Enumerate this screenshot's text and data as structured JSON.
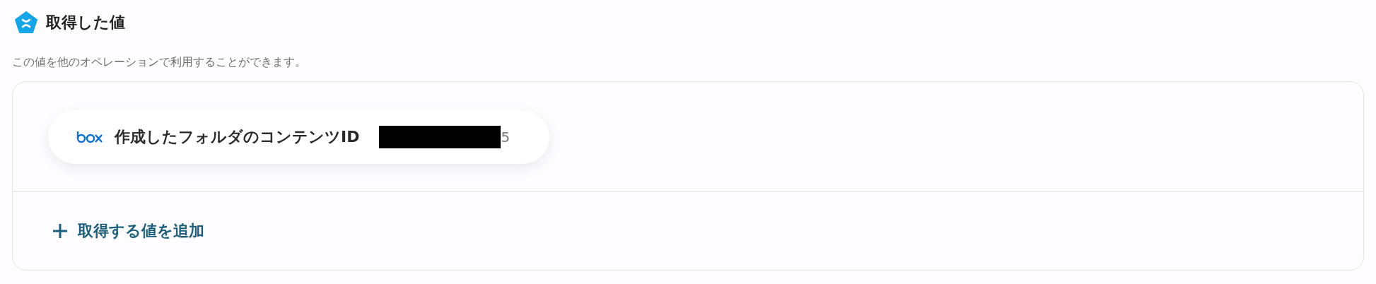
{
  "header": {
    "title": "取得した値",
    "description": "この値を他のオペレーションで利用することができます。"
  },
  "values": [
    {
      "label": "作成したフォルダのコンテンツID",
      "value": "5",
      "redacted": true
    }
  ],
  "add_button": {
    "label": "取得する値を追加"
  }
}
